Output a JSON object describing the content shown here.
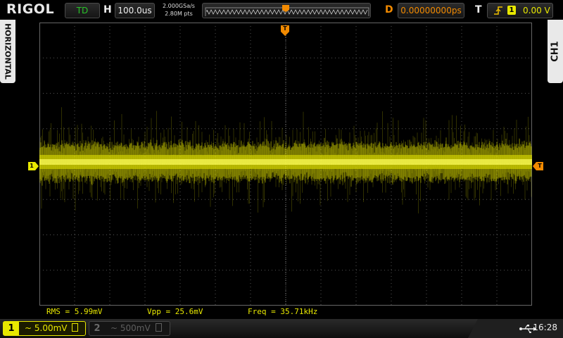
{
  "header": {
    "logo": "RIGOL",
    "run_state": "TD",
    "horizontal_label": "H",
    "timebase": "100.0us",
    "sample_rate": "2.000GSa/s",
    "memory_depth": "2.80M pts",
    "delay_label": "D",
    "delay_value": "0.00000000ps",
    "trigger_label": "T",
    "trigger_source": "1",
    "trigger_level": "0.00 V"
  },
  "side_tabs": {
    "left": "HORIZONTAL",
    "right": "CH1"
  },
  "markers": {
    "trigger_position": "T",
    "channel1_ground": "1",
    "trigger_level": "T"
  },
  "measurements": {
    "rms": "RMS = 5.99mV",
    "vpp": "Vpp = 25.6mV",
    "freq": "Freq = 35.71kHz"
  },
  "channels": [
    {
      "number": "1",
      "scale": "5.00mV",
      "active": true
    },
    {
      "number": "2",
      "scale": "500mV",
      "active": false
    }
  ],
  "status": {
    "clock": "16:28",
    "usb_icon": "usb-icon"
  },
  "colors": {
    "channel1": "#e8e800",
    "trigger": "#f28a00",
    "run_state": "#29c329",
    "background": "#000000"
  }
}
